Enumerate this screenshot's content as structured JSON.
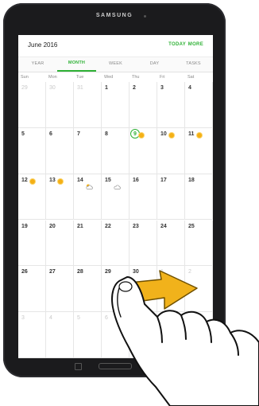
{
  "device": {
    "brand": "SAMSUNG"
  },
  "header": {
    "title": "June 2016",
    "today_label": "TODAY",
    "more_label": "MORE"
  },
  "tabs": [
    {
      "label": "YEAR",
      "active": false
    },
    {
      "label": "MONTH",
      "active": true
    },
    {
      "label": "WEEK",
      "active": false
    },
    {
      "label": "DAY",
      "active": false
    },
    {
      "label": "TASKS",
      "active": false
    }
  ],
  "weekdays": [
    "Sun",
    "Mon",
    "Tue",
    "Wed",
    "Thu",
    "Fri",
    "Sat"
  ],
  "weeks": [
    [
      {
        "d": "29",
        "m": true
      },
      {
        "d": "30",
        "m": true
      },
      {
        "d": "31",
        "m": true
      },
      {
        "d": "1"
      },
      {
        "d": "2"
      },
      {
        "d": "3"
      },
      {
        "d": "4"
      }
    ],
    [
      {
        "d": "5"
      },
      {
        "d": "6"
      },
      {
        "d": "7"
      },
      {
        "d": "8"
      },
      {
        "d": "9",
        "today": true,
        "wx": "sun"
      },
      {
        "d": "10",
        "wx": "sun"
      },
      {
        "d": "11",
        "wx": "sun"
      }
    ],
    [
      {
        "d": "12",
        "wx": "sun"
      },
      {
        "d": "13",
        "wx": "sun"
      },
      {
        "d": "14",
        "wx": "partly-cloudy"
      },
      {
        "d": "15",
        "wx": "cloudy"
      },
      {
        "d": "16"
      },
      {
        "d": "17"
      },
      {
        "d": "18"
      }
    ],
    [
      {
        "d": "19"
      },
      {
        "d": "20"
      },
      {
        "d": "21"
      },
      {
        "d": "22"
      },
      {
        "d": "23"
      },
      {
        "d": "24"
      },
      {
        "d": "25"
      }
    ],
    [
      {
        "d": "26"
      },
      {
        "d": "27"
      },
      {
        "d": "28"
      },
      {
        "d": "29"
      },
      {
        "d": "30"
      },
      {
        "d": "1",
        "m": true
      },
      {
        "d": "2",
        "m": true
      }
    ],
    [
      {
        "d": "3",
        "m": true
      },
      {
        "d": "4",
        "m": true
      },
      {
        "d": "5",
        "m": true
      },
      {
        "d": "6",
        "m": true
      },
      {
        "d": "7",
        "m": true
      },
      {
        "d": "8",
        "m": true
      },
      {
        "d": "9",
        "m": true
      }
    ]
  ],
  "fab": {
    "icon": "plus-icon",
    "label": "+"
  },
  "gesture": {
    "type": "swipe-right",
    "arrow_color": "#f1b21b",
    "accent": "#2eb135"
  }
}
